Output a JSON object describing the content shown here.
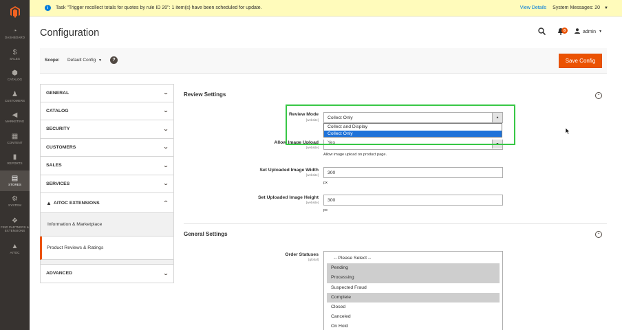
{
  "notification": {
    "text": "Task \"Trigger recollect totals for quotes by rule ID 20\": 1 item(s) have been scheduled for update.",
    "view_details": "View Details",
    "system_messages": "System Messages: 20"
  },
  "nav": {
    "items": [
      {
        "label": "DASHBOARD",
        "icon": "◔"
      },
      {
        "label": "SALES",
        "icon": "$"
      },
      {
        "label": "CATALOG",
        "icon": "⬢"
      },
      {
        "label": "CUSTOMERS",
        "icon": "♟"
      },
      {
        "label": "MARKETING",
        "icon": "📣"
      },
      {
        "label": "CONTENT",
        "icon": "▦"
      },
      {
        "label": "REPORTS",
        "icon": "▮"
      },
      {
        "label": "STORES",
        "icon": "▤"
      },
      {
        "label": "SYSTEM",
        "icon": "⚙"
      },
      {
        "label": "FIND PARTNERS & EXTENSIONS",
        "icon": "❖"
      },
      {
        "label": "AITOC",
        "icon": "▲"
      }
    ]
  },
  "header": {
    "title": "Configuration",
    "notifications_count": "8",
    "user": "admin"
  },
  "scope": {
    "label": "Scope:",
    "value": "Default Config",
    "help": "?",
    "save_label": "Save Config"
  },
  "tabs": {
    "general": "GENERAL",
    "catalog": "CATALOG",
    "security": "SECURITY",
    "customers": "CUSTOMERS",
    "sales": "SALES",
    "services": "SERVICES",
    "aitoc": "AITOC EXTENSIONS",
    "aitoc_sub": [
      "Information & Marketplace",
      "Product Reviews & Ratings"
    ],
    "advanced": "ADVANCED"
  },
  "review_settings": {
    "title": "Review Settings",
    "review_mode": {
      "label": "Review Mode",
      "scope": "[website]",
      "value": "Collect Only",
      "options": [
        "Collect and Display",
        "Collect Only"
      ]
    },
    "allow_image_upload": {
      "label": "Allow Image Upload",
      "scope": "[website]",
      "value": "Yes",
      "note": "Allow image upload on product page."
    },
    "image_width": {
      "label": "Set Uploaded Image Width",
      "scope": "[website]",
      "value": "300",
      "note": "px"
    },
    "image_height": {
      "label": "Set Uploaded Image Height",
      "scope": "[website]",
      "value": "300",
      "note": "px"
    }
  },
  "general_settings": {
    "title": "General Settings",
    "order_statuses": {
      "label": "Order Statuses",
      "scope": "[global]",
      "options": [
        {
          "label": "-- Please Select --",
          "selected": false
        },
        {
          "label": "Pending",
          "selected": true
        },
        {
          "label": "Processing",
          "selected": true
        },
        {
          "label": "Suspected Fraud",
          "selected": false
        },
        {
          "label": "Complete",
          "selected": true
        },
        {
          "label": "Closed",
          "selected": false
        },
        {
          "label": "Canceled",
          "selected": false
        },
        {
          "label": "On Hold",
          "selected": false
        }
      ]
    }
  }
}
